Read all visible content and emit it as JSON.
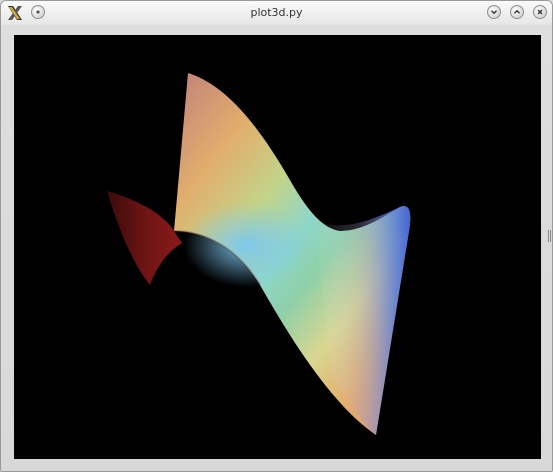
{
  "window": {
    "title": "plot3d.py"
  },
  "titlebar": {
    "app_icon": "x-logo-icon",
    "buttons": [
      {
        "name": "window-menu-button",
        "icon": "dot-icon"
      },
      {
        "name": "minimize-button",
        "icon": "chevron-down-icon"
      },
      {
        "name": "maximize-button",
        "icon": "chevron-up-icon"
      },
      {
        "name": "close-button",
        "icon": "close-icon"
      }
    ]
  },
  "plot": {
    "type": "3d-surface",
    "background_color": "#000000",
    "colormap": [
      "#8b1a1a",
      "#c07a4a",
      "#e3b86a",
      "#b8d88a",
      "#8ad0c4",
      "#6ab0e4",
      "#3a6ed8",
      "#c89aa8"
    ]
  }
}
